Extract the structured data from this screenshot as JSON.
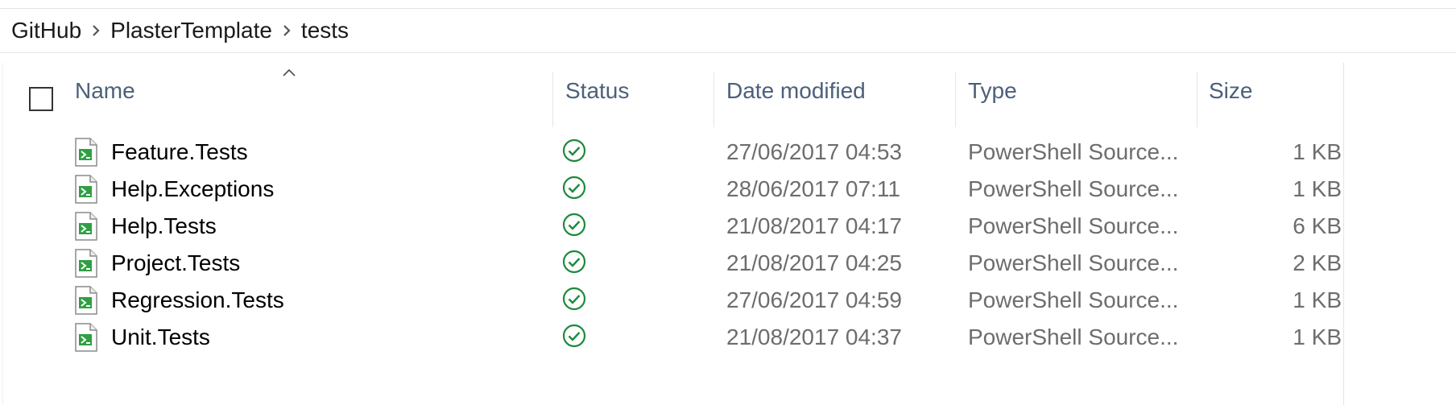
{
  "breadcrumb": [
    "GitHub",
    "PlasterTemplate",
    "tests"
  ],
  "columns": {
    "name": "Name",
    "status": "Status",
    "date_modified": "Date modified",
    "type": "Type",
    "size": "Size"
  },
  "sort": {
    "column": "Name",
    "direction": "ascending"
  },
  "files": [
    {
      "name": "Feature.Tests",
      "status": "synced",
      "date": "27/06/2017 04:53",
      "type": "PowerShell Source...",
      "size": "1 KB"
    },
    {
      "name": "Help.Exceptions",
      "status": "synced",
      "date": "28/06/2017 07:11",
      "type": "PowerShell Source...",
      "size": "1 KB"
    },
    {
      "name": "Help.Tests",
      "status": "synced",
      "date": "21/08/2017 04:17",
      "type": "PowerShell Source...",
      "size": "6 KB"
    },
    {
      "name": "Project.Tests",
      "status": "synced",
      "date": "21/08/2017 04:25",
      "type": "PowerShell Source...",
      "size": "2 KB"
    },
    {
      "name": "Regression.Tests",
      "status": "synced",
      "date": "27/06/2017 04:59",
      "type": "PowerShell Source...",
      "size": "1 KB"
    },
    {
      "name": "Unit.Tests",
      "status": "synced",
      "date": "21/08/2017 04:37",
      "type": "PowerShell Source...",
      "size": "1 KB"
    }
  ],
  "icons": {
    "file": "powershell-file-icon",
    "status": "synced-check-icon",
    "separator": "chevron-right-icon",
    "sort": "sort-ascending-icon"
  },
  "colors": {
    "header_text": "#4c607a",
    "status_green": "#1e8a3c",
    "secondary_text": "#6d6d6d",
    "icon_green": "#2ea043"
  }
}
